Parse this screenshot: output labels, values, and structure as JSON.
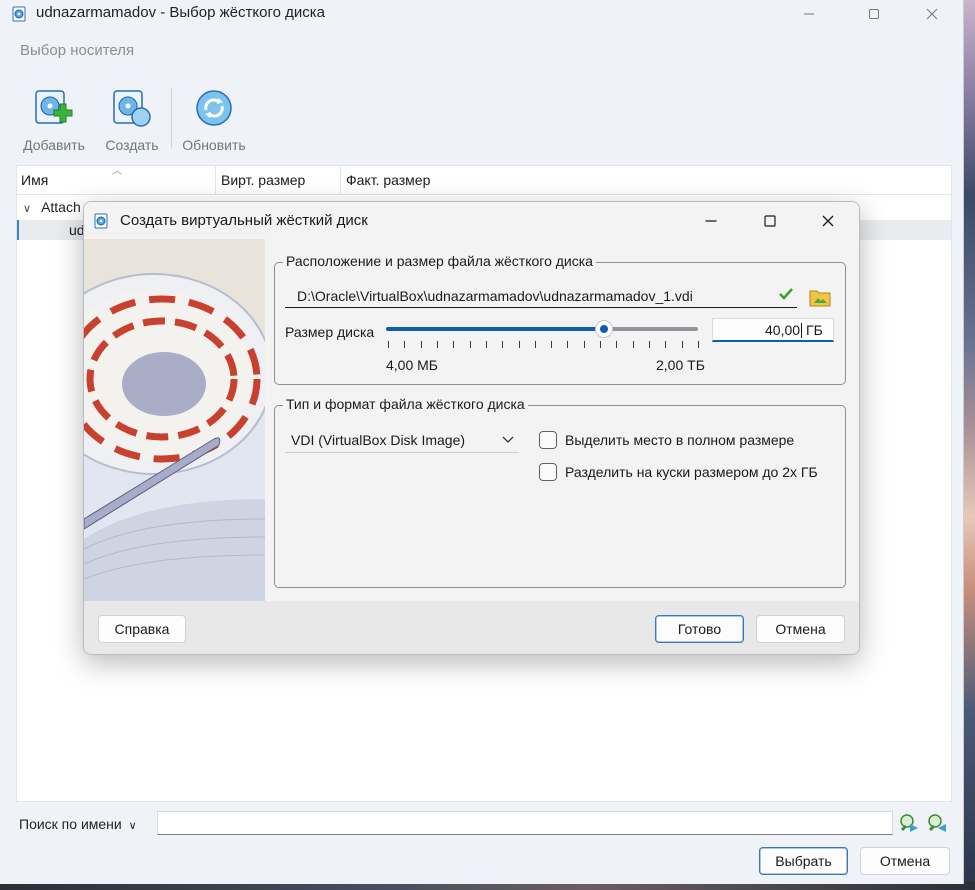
{
  "main_window": {
    "title": "udnazarmamadov - Выбор жёсткого диска",
    "section_title": "Выбор носителя",
    "toolbar": {
      "add_label": "Добавить",
      "create_label": "Создать",
      "refresh_label": "Обновить"
    },
    "list": {
      "columns": [
        "Имя",
        "Вирт. размер",
        "Факт. размер"
      ],
      "rows": [
        {
          "label": "Attach"
        },
        {
          "label": "ud"
        }
      ]
    },
    "search": {
      "mode_label": "Поиск по имени",
      "value": ""
    },
    "choose_label": "Выбрать",
    "cancel_label": "Отмена"
  },
  "dialog": {
    "title": "Создать виртуальный жёсткий диск",
    "location_group_title": "Расположение и размер файла жёсткого диска",
    "file_path": "D:\\Oracle\\VirtualBox\\udnazarmamadov\\udnazarmamadov_1.vdi",
    "size_label": "Размер диска",
    "slider": {
      "min_label": "4,00 МБ",
      "max_label": "2,00 ТБ",
      "position_fraction": 0.7
    },
    "size_value": "40,00",
    "size_unit": "ГБ",
    "format_group_title": "Тип и формат файла жёсткого диска",
    "format_selected": "VDI (VirtualBox Disk Image)",
    "options": {
      "preallocate_label": "Выделить место в полном размере",
      "preallocate_checked": false,
      "split_label": "Разделить на куски размером до 2х ГБ",
      "split_checked": false
    },
    "buttons": {
      "help": "Справка",
      "done": "Готово",
      "cancel": "Отмена"
    }
  },
  "colors": {
    "accent": "#0f5fa8",
    "window_bg": "#eff2f7",
    "dialog_bg": "#f3f3f3",
    "valid_check": "#3aa02a"
  },
  "icons": [
    "app-icon",
    "minimize-icon",
    "maximize-icon",
    "close-icon",
    "add-disk-icon",
    "create-disk-icon",
    "refresh-icon",
    "valid-check-icon",
    "folder-icon",
    "chevron-down-icon",
    "search-next-icon",
    "search-prev-icon"
  ]
}
